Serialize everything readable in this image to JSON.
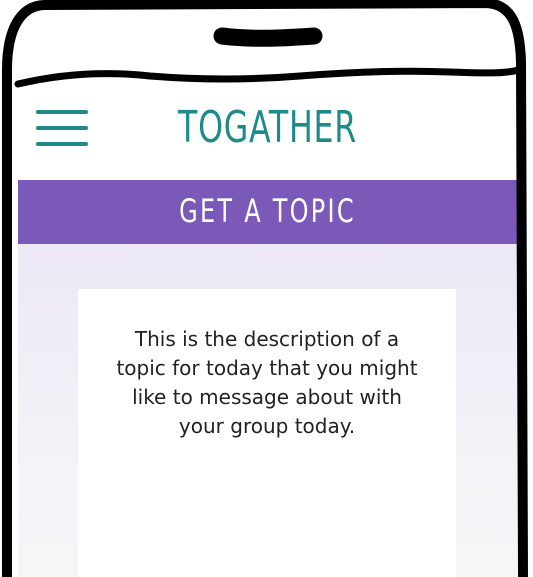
{
  "app": {
    "title": "TOGATHER",
    "menu_icon": "hamburger-menu-icon"
  },
  "section": {
    "title": "GET A TOPIC"
  },
  "topic": {
    "description": "This is the description of a topic for today that you might like to message about with your group today."
  },
  "colors": {
    "accent_teal": "#1f8a8a",
    "banner_purple": "#7b59b8",
    "content_background": "#f1eff7",
    "card_background": "#ffffff",
    "frame_ink": "#000000"
  }
}
